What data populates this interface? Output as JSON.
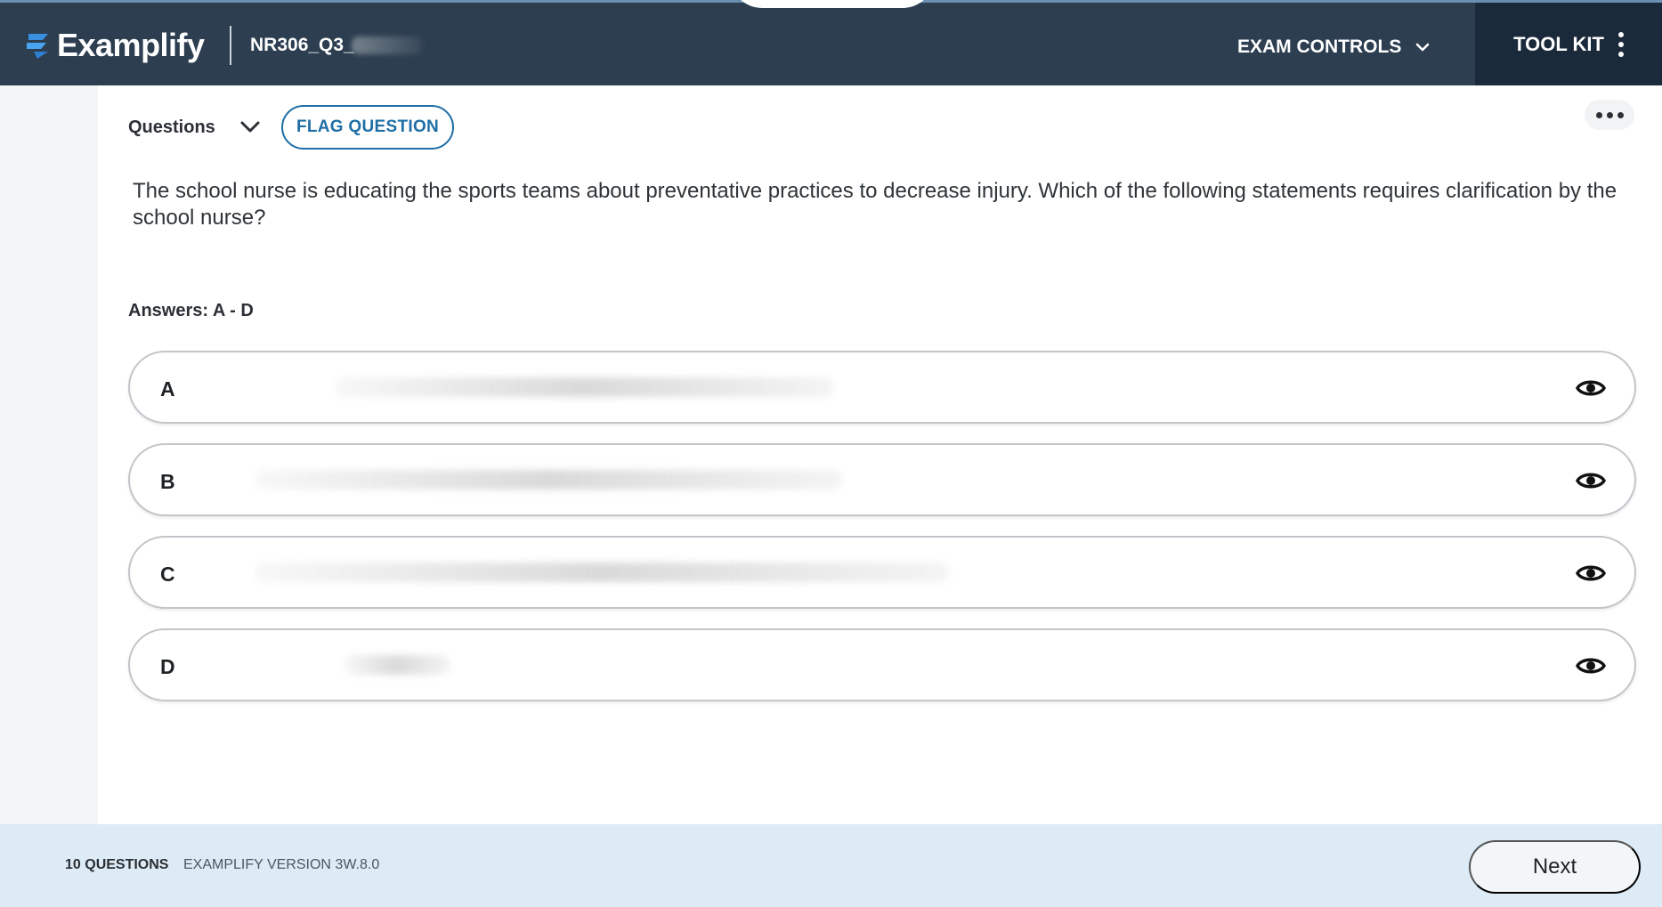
{
  "header": {
    "app_name": "Examplify",
    "exam_name": "NR306_Q3_",
    "exam_controls_label": "EXAM CONTROLS",
    "toolkit_label": "TOOL KIT"
  },
  "question_bar": {
    "question_label": "Questions",
    "flag_label": "FLAG QUESTION"
  },
  "question": {
    "text": "The school nurse is educating the sports teams about preventative practices to decrease injury. Which of the following statements requires clarification by the school nurse?"
  },
  "answers": {
    "label": "Answers: A - D",
    "items": [
      {
        "letter": "A"
      },
      {
        "letter": "B"
      },
      {
        "letter": "C"
      },
      {
        "letter": "D"
      }
    ]
  },
  "footer": {
    "question_count": "10 QUESTIONS",
    "version": "EXAMPLIFY VERSION 3W.8.0",
    "next_label": "Next"
  },
  "colors": {
    "header_bg": "#2c3e50",
    "toolkit_bg": "#1a2a3a",
    "accent": "#1f6ea6",
    "footer_bg": "#dcebf6"
  },
  "icons": {
    "logo": "examplify-logo-icon",
    "exam_controls": "chevron-down-icon",
    "toolkit": "kebab-menu-icon",
    "question_select": "chevron-down-icon",
    "more": "more-horizontal-icon",
    "answer_reveal": "eye-icon"
  }
}
